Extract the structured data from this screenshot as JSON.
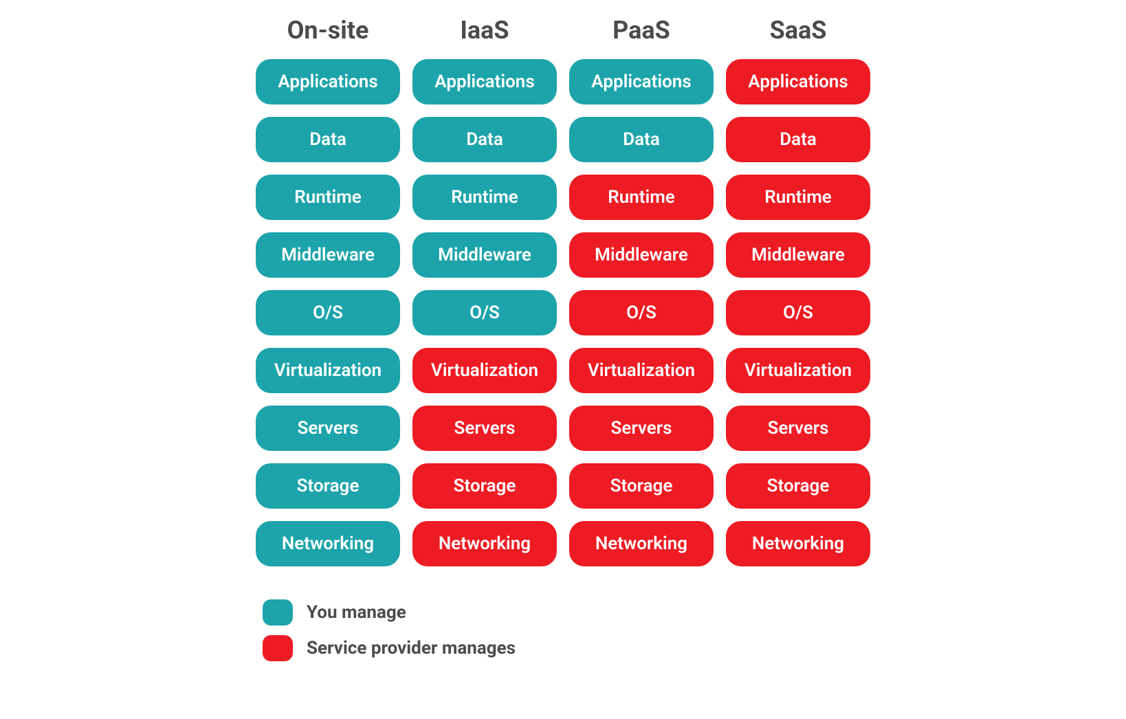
{
  "columns": [
    {
      "header": "On-site",
      "managed": [
        "you",
        "you",
        "you",
        "you",
        "you",
        "you",
        "you",
        "you",
        "you"
      ]
    },
    {
      "header": "IaaS",
      "managed": [
        "you",
        "you",
        "you",
        "you",
        "you",
        "provider",
        "provider",
        "provider",
        "provider"
      ]
    },
    {
      "header": "PaaS",
      "managed": [
        "you",
        "you",
        "provider",
        "provider",
        "provider",
        "provider",
        "provider",
        "provider",
        "provider"
      ]
    },
    {
      "header": "SaaS",
      "managed": [
        "provider",
        "provider",
        "provider",
        "provider",
        "provider",
        "provider",
        "provider",
        "provider",
        "provider"
      ]
    }
  ],
  "layers": [
    "Applications",
    "Data",
    "Runtime",
    "Middleware",
    "O/S",
    "Virtualization",
    "Servers",
    "Storage",
    "Networking"
  ],
  "legend": {
    "you": "You manage",
    "provider": "Service provider manages"
  },
  "colors": {
    "you": "#1da4aa",
    "provider": "#ed1b23",
    "headerText": "#4b4b4b"
  }
}
